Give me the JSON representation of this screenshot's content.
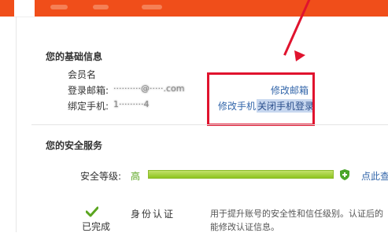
{
  "basic_info": {
    "title": "您的基础信息",
    "member_label": "会员名",
    "member_value": "",
    "email_label": "登录邮箱:",
    "email_value": "··········@·····.com",
    "phone_label": "绑定手机:",
    "phone_value": "1·········4",
    "edit_email": "修改邮箱",
    "edit_phone": "修改手机",
    "disable_phone_login": "关闭手机登录"
  },
  "security": {
    "title": "您的安全服务",
    "level_label": "安全等级:",
    "level_value": "高",
    "level_fraction": 1.0,
    "tip_link": "点此查",
    "item_title": "身份认证",
    "item_status": "已完成",
    "item_desc_line1": "用于提升账号的安全性和信任级别。认证后的",
    "item_desc_line2": "能修改认证信息。"
  },
  "colors": {
    "header": "#f04e1a",
    "highlight_box": "#e0132e",
    "link": "#3366aa",
    "level_high": "#5aa51f"
  }
}
